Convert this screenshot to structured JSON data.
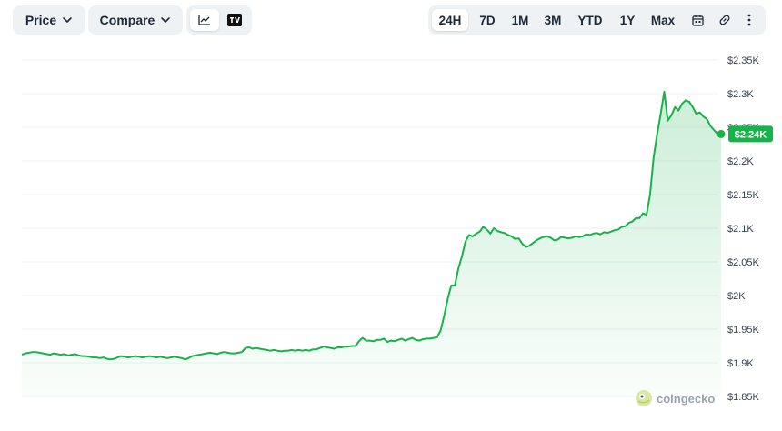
{
  "toolbar": {
    "price_label": "Price",
    "compare_label": "Compare",
    "line_view_icon": "line-chart-icon",
    "tradingview_icon": "tradingview-icon",
    "ranges": [
      "24H",
      "7D",
      "1M",
      "3M",
      "YTD",
      "1Y",
      "Max"
    ],
    "active_range": "24H",
    "calendar_icon": "calendar-icon",
    "link_icon": "link-icon",
    "more_icon": "more-vertical-icon"
  },
  "watermark": {
    "text": "coingecko",
    "logo": "coingecko-logo"
  },
  "colors": {
    "line": "#16b34a",
    "badge": "#16b34a",
    "grid": "#eef0f3",
    "fill_top": "#16b34a"
  },
  "chart_data": {
    "type": "area",
    "currency_axis": "right",
    "y_ticks": [
      1850,
      1900,
      1950,
      2000,
      2050,
      2100,
      2150,
      2200,
      2250,
      2300,
      2350
    ],
    "y_tick_labels": [
      "$1.85K",
      "$1.9K",
      "$1.95K",
      "$2K",
      "$2.05K",
      "$2.1K",
      "$2.15K",
      "$2.2K",
      "$2.25K",
      "$2.3K",
      "$2.35K"
    ],
    "ylim": [
      1850,
      2350
    ],
    "grid": true,
    "current_value": 2240,
    "current_label": "$2.24K",
    "values": [
      1912,
      1914,
      1915,
      1916,
      1916,
      1915,
      1914,
      1913,
      1912,
      1914,
      1913,
      1912,
      1913,
      1911,
      1912,
      1913,
      1911,
      1910,
      1910,
      1909,
      1908,
      1908,
      1907,
      1908,
      1906,
      1905,
      1906,
      1908,
      1910,
      1909,
      1908,
      1909,
      1910,
      1909,
      1908,
      1909,
      1910,
      1909,
      1908,
      1909,
      1908,
      1907,
      1908,
      1909,
      1908,
      1907,
      1905,
      1907,
      1910,
      1911,
      1912,
      1913,
      1914,
      1915,
      1914,
      1913,
      1915,
      1916,
      1915,
      1914,
      1914,
      1915,
      1916,
      1922,
      1923,
      1921,
      1922,
      1921,
      1920,
      1919,
      1918,
      1919,
      1918,
      1917,
      1918,
      1918,
      1919,
      1918,
      1919,
      1918,
      1919,
      1918,
      1920,
      1920,
      1922,
      1924,
      1923,
      1922,
      1921,
      1923,
      1923,
      1924,
      1924,
      1925,
      1925,
      1932,
      1937,
      1933,
      1933,
      1932,
      1934,
      1934,
      1936,
      1931,
      1933,
      1932,
      1934,
      1936,
      1933,
      1935,
      1937,
      1934,
      1933,
      1935,
      1936,
      1936,
      1937,
      1938,
      1948,
      1970,
      1995,
      2015,
      2015,
      2040,
      2058,
      2080,
      2090,
      2088,
      2092,
      2095,
      2102,
      2098,
      2092,
      2100,
      2096,
      2094,
      2093,
      2090,
      2088,
      2084,
      2085,
      2077,
      2072,
      2074,
      2078,
      2082,
      2085,
      2087,
      2088,
      2086,
      2082,
      2083,
      2087,
      2086,
      2085,
      2086,
      2088,
      2087,
      2088,
      2091,
      2090,
      2092,
      2093,
      2091,
      2094,
      2093,
      2095,
      2097,
      2098,
      2102,
      2103,
      2108,
      2110,
      2115,
      2115,
      2122,
      2120,
      2150,
      2205,
      2240,
      2270,
      2303,
      2260,
      2268,
      2280,
      2275,
      2285,
      2290,
      2288,
      2280,
      2270,
      2272,
      2266,
      2262,
      2252,
      2246,
      2240,
      2245
    ]
  }
}
